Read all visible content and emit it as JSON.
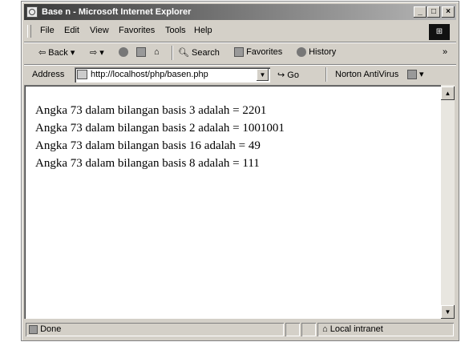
{
  "window": {
    "title": "Base n - Microsoft Internet Explorer"
  },
  "title_buttons": {
    "minimize": "_",
    "maximize": "□",
    "close": "×"
  },
  "menu": [
    {
      "label": "File"
    },
    {
      "label": "Edit"
    },
    {
      "label": "View"
    },
    {
      "label": "Favorites"
    },
    {
      "label": "Tools"
    },
    {
      "label": "Help"
    }
  ],
  "toolbar": {
    "back": "Back",
    "search": "Search",
    "favorites": "Favorites",
    "history": "History",
    "more": "»"
  },
  "address": {
    "label": "Address",
    "url": "http://localhost/php/basen.php",
    "go": "Go",
    "norton": "Norton AntiVirus"
  },
  "content": {
    "lines": [
      "Angka 73 dalam bilangan basis 3 adalah = 2201",
      "Angka 73 dalam bilangan basis 2 adalah = 1001001",
      "Angka 73 dalam bilangan basis 16 adalah = 49",
      "Angka 73 dalam bilangan basis 8 adalah = 111"
    ]
  },
  "status": {
    "left": "Done",
    "zone": "Local intranet"
  }
}
